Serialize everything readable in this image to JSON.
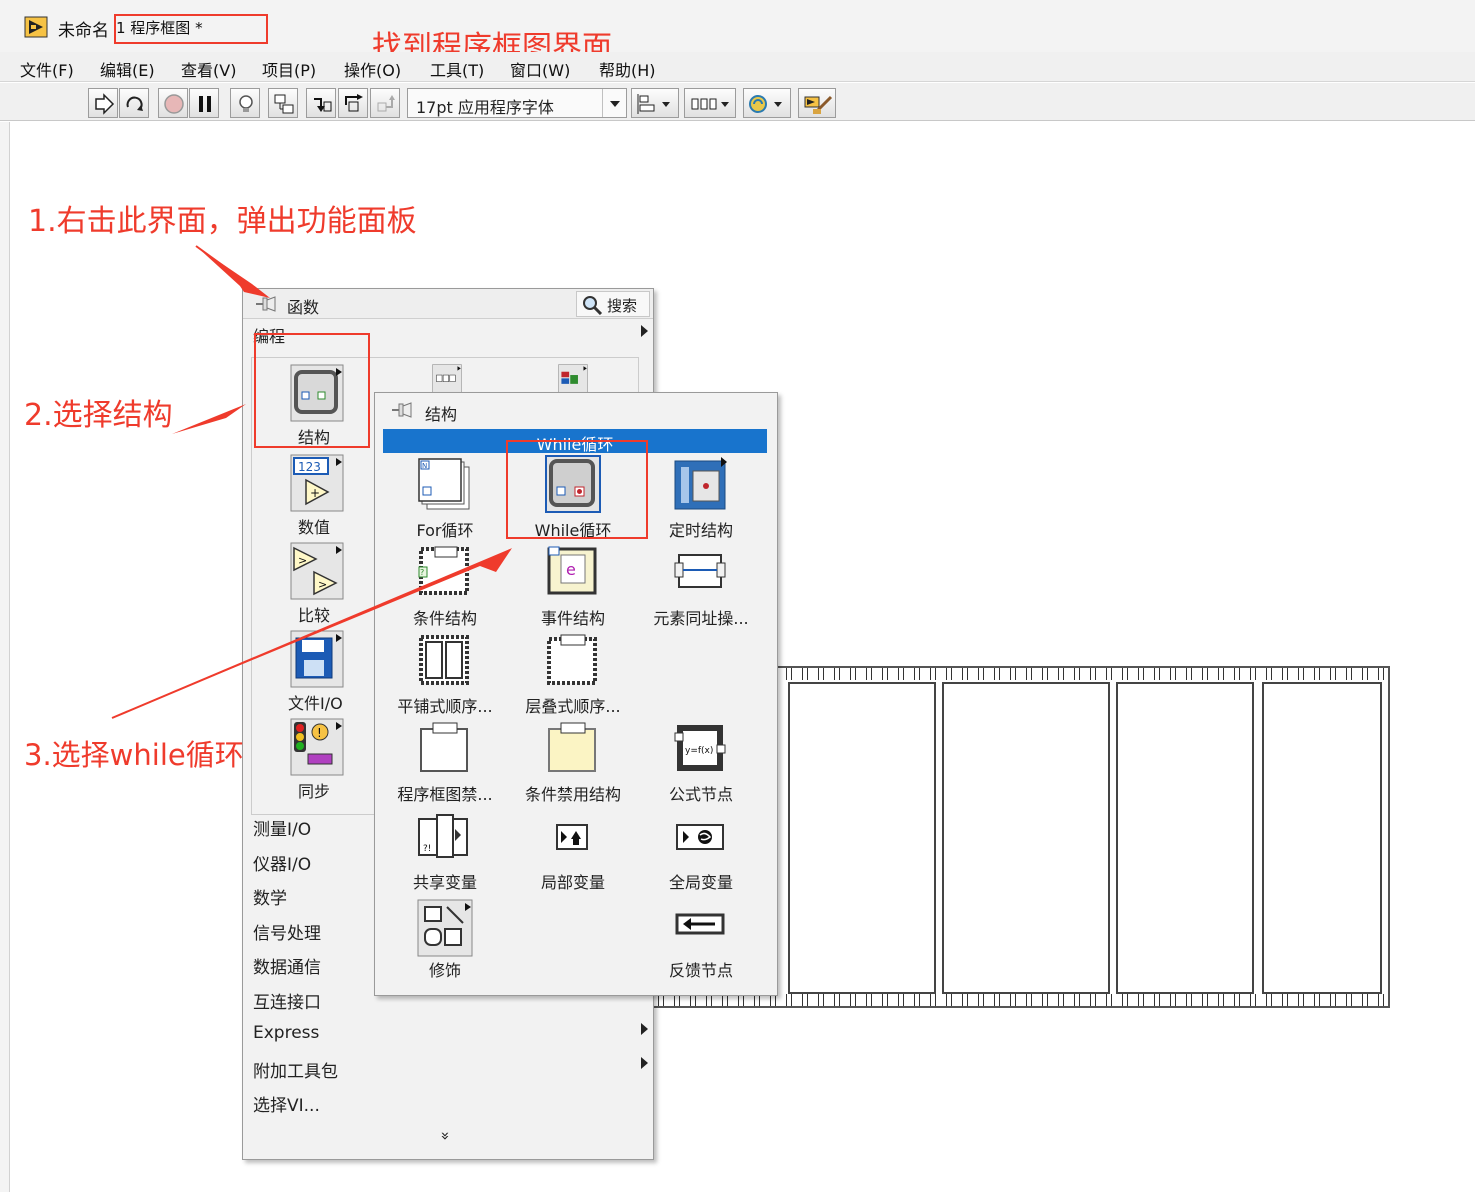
{
  "window": {
    "title": "未命名",
    "tab_title": "1 程序框图 *"
  },
  "menu": [
    "文件(F)",
    "编辑(E)",
    "查看(V)",
    "项目(P)",
    "操作(O)",
    "工具(T)",
    "窗口(W)",
    "帮助(H)"
  ],
  "toolbar": {
    "font": "17pt 应用程序字体",
    "icons": [
      "run-arrow-icon",
      "run-continuously-icon",
      "abort-icon",
      "pause-icon",
      "highlight-execution-icon",
      "retain-wire-values-icon",
      "step-into-icon",
      "step-over-icon",
      "step-out-icon",
      "align-icon",
      "distribute-icon",
      "reorder-icon",
      "cleanup-icon"
    ]
  },
  "annotations": {
    "find_view": "找到程序框图界面",
    "step1": "1.右击此界面，弹出功能面板",
    "step2": "2.选择结构",
    "step3": "3.选择while循环"
  },
  "functions_palette": {
    "title": "函数",
    "search": "搜索",
    "category": "编程",
    "icons": [
      {
        "name": "structures",
        "label": "结构"
      },
      {
        "name": "numeric",
        "label": "数值"
      },
      {
        "name": "comparison",
        "label": "比较"
      },
      {
        "name": "file-io",
        "label": "文件I/O"
      },
      {
        "name": "synchronization",
        "label": "同步"
      }
    ],
    "categories": [
      "测量I/O",
      "仪器I/O",
      "数学",
      "信号处理",
      "数据通信",
      "互连接口",
      "Express",
      "附加工具包",
      "选择VI..."
    ],
    "more": "»"
  },
  "structures_palette": {
    "title": "结构",
    "hover_label": "While循环",
    "items": [
      "For循环",
      "While循环",
      "定时结构",
      "条件结构",
      "事件结构",
      "元素同址操...",
      "平铺式顺序...",
      "层叠式顺序...",
      "",
      "程序框图禁...",
      "条件禁用结构",
      "公式节点",
      "共享变量",
      "局部变量",
      "全局变量",
      "修饰",
      "",
      "反馈节点"
    ]
  },
  "colors": {
    "annotation_red": "#ef3b2c",
    "highlight_blue": "#1874cd"
  }
}
